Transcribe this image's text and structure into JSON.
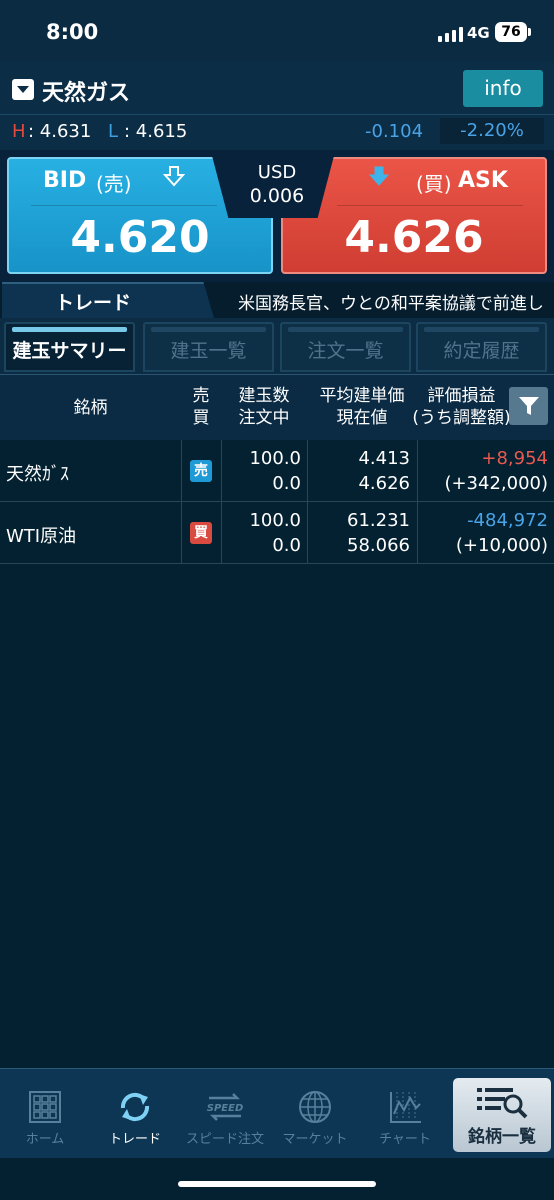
{
  "status_bar": {
    "time": "8:00",
    "network": "4G",
    "battery": "76"
  },
  "header": {
    "symbol": "天然ガス",
    "info_label": "info"
  },
  "range": {
    "high_label": "H",
    "high_value": ": 4.631",
    "low_label": "L",
    "low_value": ": 4.615",
    "change": "-0.104",
    "change_percent": "-2.20%"
  },
  "quote": {
    "bid_label": "BID",
    "bid_side": "(売)",
    "bid_price": "4.620",
    "ask_label": "ASK",
    "ask_side": "(買)",
    "ask_price": "4.626",
    "spread_currency": "USD",
    "spread_value": "0.006"
  },
  "trade_bar": {
    "label": "トレード",
    "news": "米国務長官、ウとの和平案協議で前進し"
  },
  "tabs": [
    "建玉サマリー",
    "建玉一覧",
    "注文一覧",
    "約定履歴"
  ],
  "table": {
    "headers": {
      "name": "銘柄",
      "side": "売\n買",
      "qty": "建玉数\n注文中",
      "price": "平均建単価\n現在値",
      "pl": "評価損益\n(うち調整額)"
    },
    "rows": [
      {
        "name": "天然ｶﾞｽ",
        "side": "売",
        "qty": "100.0",
        "pending": "0.0",
        "avg_price": "4.413",
        "current_price": "4.626",
        "pl": "+8,954",
        "adjustment": "(+342,000)"
      },
      {
        "name": "WTI原油",
        "side": "買",
        "qty": "100.0",
        "pending": "0.0",
        "avg_price": "61.231",
        "current_price": "58.066",
        "pl": "-484,972",
        "adjustment": "(+10,000)"
      }
    ]
  },
  "nav": {
    "home": "ホーム",
    "trade": "トレード",
    "speed": "スピード注文",
    "speed_icon_text": "SPEED",
    "market": "マーケット",
    "chart": "チャート",
    "list": "銘柄一覧"
  },
  "colors": {
    "bid": "#1fa3d8",
    "ask": "#e14b3f",
    "profit": "#e85a4f",
    "loss": "#4aa3e6"
  }
}
